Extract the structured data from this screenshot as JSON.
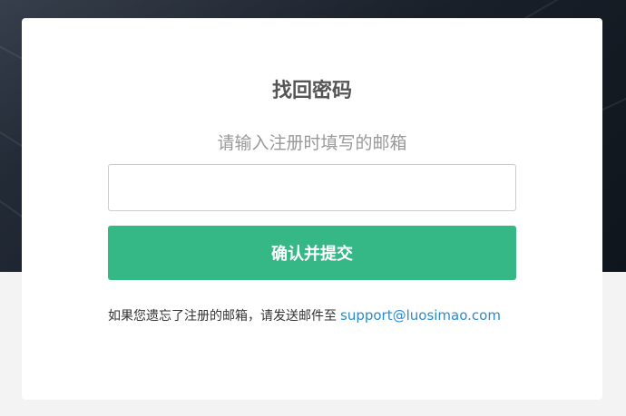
{
  "card": {
    "title": "找回密码",
    "subtitle": "请输入注册时填写的邮箱",
    "email_input": {
      "value": "",
      "placeholder": ""
    },
    "submit_label": "确认并提交",
    "note_text": "如果您遗忘了注册的邮箱，请发送邮件至",
    "support_email": "support@luosimao.com"
  },
  "colors": {
    "primary_button": "#36b786",
    "link": "#2a8ccb",
    "title": "#555555",
    "subtitle": "#999999",
    "background_dark": "#1a212b",
    "background_light": "#f3f3f3"
  }
}
